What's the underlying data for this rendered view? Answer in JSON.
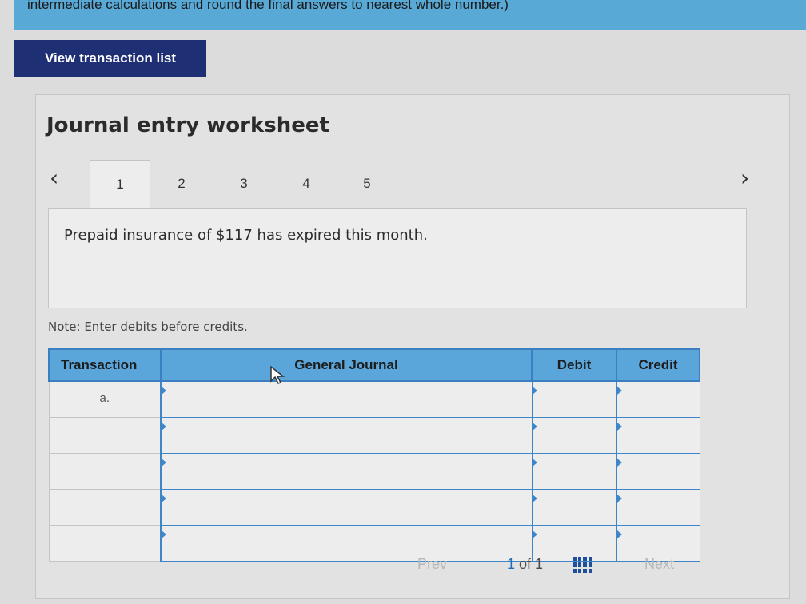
{
  "header": {
    "instructions": "intermediate calculations and round the final answers to nearest whole number.)",
    "view_button": "View transaction list"
  },
  "worksheet": {
    "title": "Journal entry worksheet",
    "tabs": [
      "1",
      "2",
      "3",
      "4",
      "5"
    ],
    "active_tab": "1",
    "description": "Prepaid insurance of $117 has expired this month.",
    "note": "Note: Enter debits before credits."
  },
  "journal": {
    "headers": {
      "transaction": "Transaction",
      "general_journal": "General Journal",
      "debit": "Debit",
      "credit": "Credit"
    },
    "rows": [
      {
        "transaction": "a."
      },
      {
        "transaction": ""
      },
      {
        "transaction": ""
      },
      {
        "transaction": ""
      },
      {
        "transaction": ""
      }
    ]
  },
  "pagination": {
    "prev": "Prev",
    "current": "1",
    "of_text": "of 1",
    "next": "Next"
  },
  "icons": {
    "left": "chevron-left-icon",
    "right": "chevron-right-icon",
    "grid": "grid-icon"
  }
}
